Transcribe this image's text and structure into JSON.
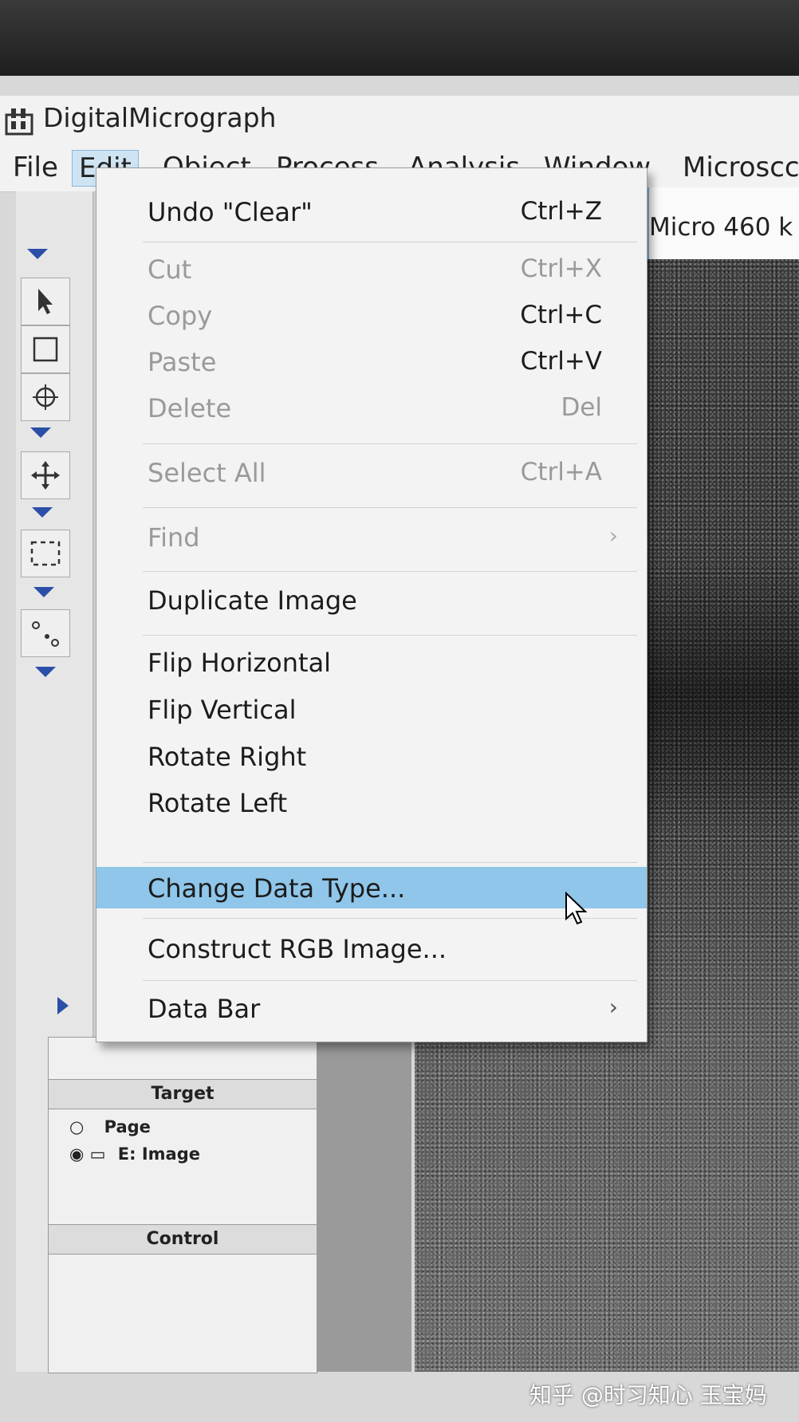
{
  "app": {
    "title": "DigitalMicrograph",
    "icon": "building-icon"
  },
  "menubar": {
    "items": [
      {
        "label": "File",
        "active": false
      },
      {
        "label": "Edit",
        "active": true
      },
      {
        "label": "Object",
        "active": false
      },
      {
        "label": "Process",
        "active": false
      },
      {
        "label": "Analysis",
        "active": false
      },
      {
        "label": "Window",
        "active": false
      },
      {
        "label": "Microscc",
        "active": false
      }
    ]
  },
  "window": {
    "title_fragment": "Micro 460 k"
  },
  "edit_menu": {
    "items": [
      {
        "label": "Undo \"Clear\"",
        "shortcut": "Ctrl+Z",
        "enabled": true
      },
      {
        "label": "Cut",
        "shortcut": "Ctrl+X",
        "enabled": false
      },
      {
        "label": "Copy",
        "shortcut": "Ctrl+C",
        "enabled": false
      },
      {
        "label": "Paste",
        "shortcut": "Ctrl+V",
        "enabled": false
      },
      {
        "label": "Delete",
        "shortcut": "Del",
        "enabled": false
      },
      {
        "label": "Select All",
        "shortcut": "Ctrl+A",
        "enabled": false
      },
      {
        "label": "Find",
        "shortcut": "",
        "enabled": false,
        "submenu": true
      },
      {
        "label": "Duplicate Image",
        "shortcut": "",
        "enabled": true
      },
      {
        "label": "Flip Horizontal",
        "shortcut": "",
        "enabled": true
      },
      {
        "label": "Flip Vertical",
        "shortcut": "",
        "enabled": true
      },
      {
        "label": "Rotate Right",
        "shortcut": "",
        "enabled": true
      },
      {
        "label": "Rotate Left",
        "shortcut": "",
        "enabled": true
      },
      {
        "label": "Change Data Type...",
        "shortcut": "",
        "enabled": true,
        "highlighted": true
      },
      {
        "label": "Construct RGB Image...",
        "shortcut": "",
        "enabled": true
      },
      {
        "label": "Data Bar",
        "shortcut": "",
        "enabled": true,
        "submenu": true
      }
    ],
    "submenu_arrow": "›"
  },
  "panel": {
    "target_header": "Target",
    "options": [
      {
        "label": "Page",
        "selected": false
      },
      {
        "label": "E: Image",
        "selected": true
      }
    ],
    "control_header": "Control"
  },
  "watermark": "知乎 @时习知心 玉宝妈",
  "colors": {
    "highlight": "#8fc6ea",
    "menu_bg": "#f3f3f3",
    "disabled_text": "#9a9a9a",
    "triangle": "#2b4fa8"
  }
}
